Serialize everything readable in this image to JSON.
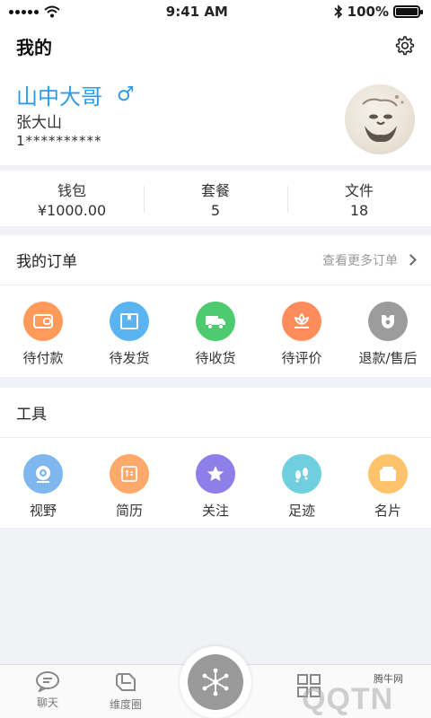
{
  "status_bar": {
    "time": "9:41 AM",
    "battery": "100%",
    "battery_level": 1.0
  },
  "header": {
    "title": "我的",
    "settings_icon": "gear-icon"
  },
  "profile": {
    "nickname": "山中大哥",
    "gender_symbol": "♂",
    "real_name": "张大山",
    "phone": "1**********"
  },
  "stats": [
    {
      "label": "钱包",
      "value": "¥1000.00"
    },
    {
      "label": "套餐",
      "value": "5"
    },
    {
      "label": "文件",
      "value": "18"
    }
  ],
  "orders": {
    "title": "我的订单",
    "more_label": "查看更多订单",
    "items": [
      {
        "label": "待付款",
        "icon": "wallet-icon",
        "color": "#ff9a5a"
      },
      {
        "label": "待发货",
        "icon": "package-icon",
        "color": "#5ab4f2"
      },
      {
        "label": "待收货",
        "icon": "truck-icon",
        "color": "#4ecb6e"
      },
      {
        "label": "待评价",
        "icon": "flower-icon",
        "color": "#ff8c5a"
      },
      {
        "label": "退款/售后",
        "icon": "service-icon",
        "color": "#9c9c9c"
      }
    ]
  },
  "tools": {
    "title": "工具",
    "items": [
      {
        "label": "视野",
        "icon": "camera-icon",
        "color": "#7eb6ef"
      },
      {
        "label": "简历",
        "icon": "resume-icon",
        "color": "#ffa96c"
      },
      {
        "label": "关注",
        "icon": "star-icon",
        "color": "#8d7ee8"
      },
      {
        "label": "足迹",
        "icon": "footprint-icon",
        "color": "#6fcfdf"
      },
      {
        "label": "名片",
        "icon": "card-icon",
        "color": "#ffc36b"
      }
    ]
  },
  "tabbar": {
    "items": [
      {
        "label": "聊天",
        "icon": "chat-icon"
      },
      {
        "label": "维度圈",
        "icon": "circle-icon"
      }
    ],
    "center_icon": "network-icon",
    "watermark": "QQTN",
    "watermark_small": "腾牛网"
  }
}
